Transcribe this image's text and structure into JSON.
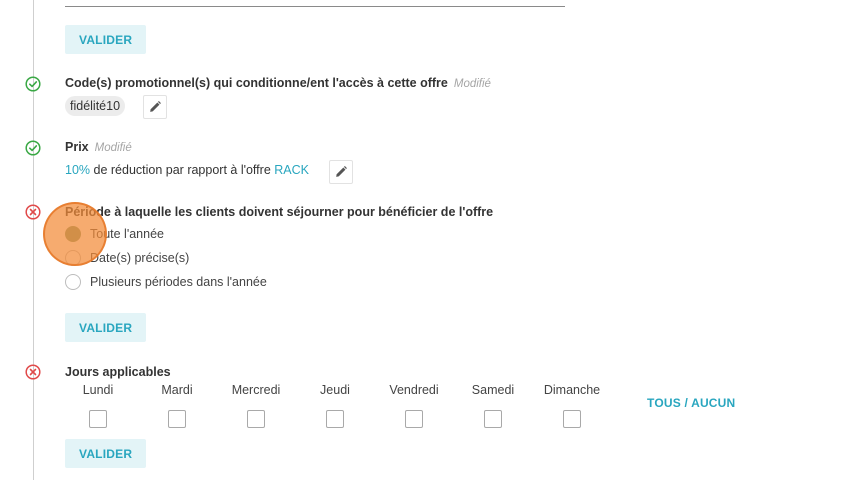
{
  "buttons": {
    "valider": "VALIDER"
  },
  "promo": {
    "title": "Code(s) promotionnel(s) qui conditionne/ent l'accès à cette offre",
    "status_text": "Modifié",
    "chip": "fidélité10"
  },
  "prix": {
    "title": "Prix",
    "status_text": "Modifié",
    "percent": "10%",
    "middle_text": " de réduction par rapport à l'offre ",
    "offer": "RACK"
  },
  "periode": {
    "title": "Période à laquelle les clients doivent séjourner pour bénéficier de l'offre",
    "options": [
      {
        "label": "Toute l'année",
        "selected": true
      },
      {
        "label": "Date(s) précise(s)",
        "selected": false
      },
      {
        "label": "Plusieurs périodes dans l'année",
        "selected": false
      }
    ]
  },
  "jours": {
    "title": "Jours applicables",
    "days": [
      "Lundi",
      "Mardi",
      "Mercredi",
      "Jeudi",
      "Vendredi",
      "Samedi",
      "Dimanche"
    ],
    "toggle_all": "TOUS / AUCUN"
  },
  "icons": {
    "done": "check-circle-icon",
    "error": "x-circle-icon",
    "edit": "pencil-icon"
  },
  "colors": {
    "accent": "#29a6bf",
    "button_bg": "#e3f4f7",
    "success": "#3aa845",
    "error": "#e04a4a",
    "radio_selected": "#7a9b72",
    "cursor_highlight": "#f28b38"
  }
}
